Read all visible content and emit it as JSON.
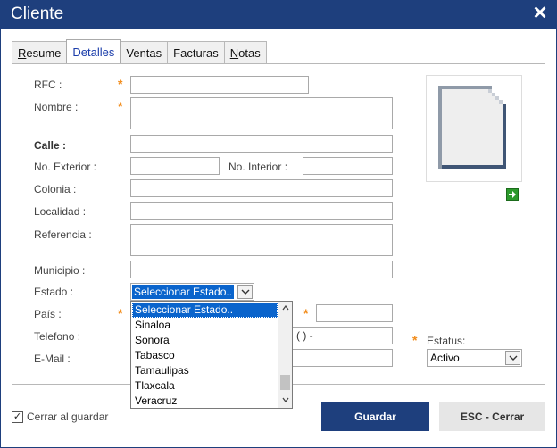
{
  "window": {
    "title": "Cliente",
    "close_symbol": "✕"
  },
  "tabs": [
    {
      "label": "Resume",
      "hotkey": "R",
      "rest": "esume"
    },
    {
      "label": "Detalles"
    },
    {
      "label": "Ventas"
    },
    {
      "label": "Facturas"
    },
    {
      "label": "Notas",
      "hotkey": "N",
      "rest": "otas"
    }
  ],
  "form": {
    "rfc_label": "RFC :",
    "nombre_label": "Nombre :",
    "calle_label": "Calle :",
    "no_exterior_label": "No. Exterior :",
    "no_interior_label": "No. Interior :",
    "colonia_label": "Colonia :",
    "localidad_label": "Localidad :",
    "referencia_label": "Referencia :",
    "municipio_label": "Municipio :",
    "estado_label": "Estado :",
    "pais_label": "País :",
    "telefono_label": "Telefono :",
    "email_label": "E-Mail :",
    "estatus_label": "Estatus:",
    "required_mark": "*",
    "phone_mask": "(   )   -"
  },
  "estado_select": {
    "selected": "Seleccionar Estado..",
    "options": [
      "Seleccionar Estado..",
      "Sinaloa",
      "Sonora",
      "Tabasco",
      "Tamaulipas",
      "Tlaxcala",
      "Veracruz"
    ]
  },
  "estatus_select": {
    "selected": "Activo"
  },
  "footer": {
    "checkbox_label": "Cerrar al guardar",
    "checkbox_checked": true,
    "checkbox_mark": "✓",
    "save_label": "Guardar",
    "cancel_label": "ESC - Cerrar"
  },
  "colors": {
    "titlebar": "#1e3f7d",
    "required": "#f28c1a",
    "selection": "#0a64cc"
  },
  "icons": {
    "photo": "document-placeholder-icon",
    "arrow": "arrow-right-icon",
    "close": "close-icon",
    "dropdown": "chevron-down-icon"
  }
}
